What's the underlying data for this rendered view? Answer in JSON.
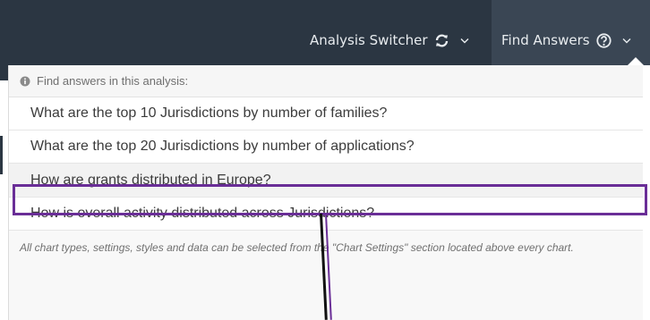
{
  "nav": {
    "switcher_label": "Analysis Switcher",
    "find_label": "Find Answers"
  },
  "dropdown": {
    "header": "Find answers in this analysis:",
    "questions": [
      "What are the top 10 Jurisdictions by number of families?",
      "What are the top 20 Jurisdictions by number of applications?",
      "How are grants distributed in Europe?",
      "How is overall activity distributed across Jurisdictions?"
    ],
    "highlighted_index": 2,
    "footer": "All chart types, settings, styles and data can be selected from the \"Chart Settings\" section located above every chart."
  },
  "colors": {
    "topbar": "#2b3642",
    "highlight": "#6a2e97"
  }
}
